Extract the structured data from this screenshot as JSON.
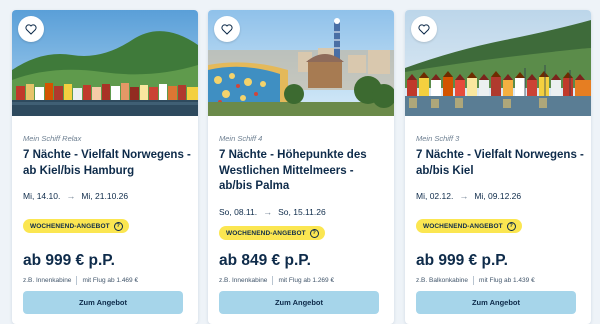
{
  "cards": [
    {
      "ship": "Mein Schiff Relax",
      "title": "7 Nächte - Vielfalt Norwegens - ab Kiel/bis Hamburg",
      "date_from": "Mi, 14.10.",
      "date_to": "Mi, 21.10.26",
      "badge": "WOCHENEND-ANGEBOT",
      "price": "ab 999 € p.P.",
      "cabin": "z.B. Innenkabine",
      "flight": "mit Flug ab 1.469 €",
      "cta": "Zum Angebot",
      "image": "bergen-harbour-houses"
    },
    {
      "ship": "Mein Schiff 4",
      "title": "7 Nächte - Höhepunkte des Westlichen Mittelmeers - ab/bis Palma",
      "date_from": "So, 08.11.",
      "date_to": "So, 15.11.26",
      "badge": "WOCHENEND-ANGEBOT",
      "price": "ab 849 € p.P.",
      "cabin": "z.B. Innenkabine",
      "flight": "mit Flug ab 1.269 €",
      "cta": "Zum Angebot",
      "image": "park-guell-barcelona"
    },
    {
      "ship": "Mein Schiff 3",
      "title": "7 Nächte - Vielfalt Norwegens - ab/bis Kiel",
      "date_from": "Mi, 02.12.",
      "date_to": "Mi, 09.12.26",
      "badge": "WOCHENEND-ANGEBOT",
      "price": "ab 999 € p.P.",
      "cabin": "z.B. Balkonkabine",
      "flight": "mit Flug ab 1.439 €",
      "cta": "Zum Angebot",
      "image": "bergen-waterfront"
    }
  ],
  "icons": {
    "favorite": "heart-outline-icon",
    "arrow": "arrow-right-icon",
    "info": "info-icon"
  },
  "colors": {
    "text": "#0e2b4a",
    "badge": "#fbe651",
    "cta": "#a6d5ea",
    "background": "#eef3f8"
  }
}
